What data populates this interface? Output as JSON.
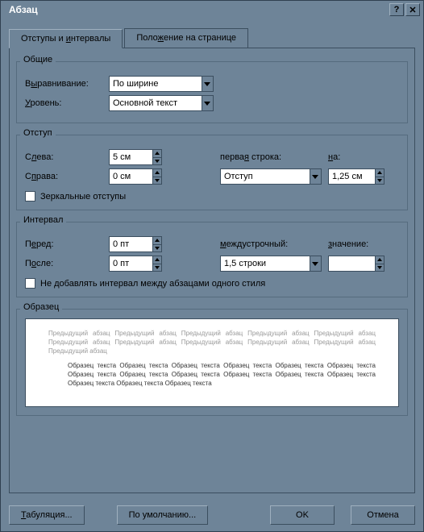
{
  "title": "Абзац",
  "tabs": {
    "indents": "Отступы и интервалы",
    "position": "Положение на странице"
  },
  "group_general": {
    "title": "Общие",
    "alignment_label": "Выравнивание:",
    "alignment_value": "По ширине",
    "level_label": "Уровень:",
    "level_value": "Основной текст"
  },
  "group_indent": {
    "title": "Отступ",
    "left_label": "Слева:",
    "left_value": "5 см",
    "right_label": "Справа:",
    "right_value": "0 см",
    "firstline_label": "первая строка:",
    "firstline_value": "Отступ",
    "by_label": "на:",
    "by_value": "1,25 см",
    "mirror_label": "Зеркальные отступы"
  },
  "group_spacing": {
    "title": "Интервал",
    "before_label": "Перед:",
    "before_value": "0 пт",
    "after_label": "После:",
    "after_value": "0 пт",
    "line_label": "междустрочный:",
    "line_value": "1,5 строки",
    "val_label": "значение:",
    "val_value": "",
    "noadd_label": "Не добавлять интервал между абзацами одного стиля"
  },
  "preview": {
    "title": "Образец",
    "prev_text": "Предыдущий абзац Предыдущий абзац Предыдущий абзац Предыдущий абзац Предыдущий абзац Предыдущий абзац Предыдущий абзац Предыдущий абзац Предыдущий абзац Предыдущий абзац Предыдущий абзац",
    "curr_text": "Образец текста Образец текста Образец текста Образец текста Образец текста Образец текста Образец текста Образец текста Образец текста Образец текста Образец текста Образец текста Образец текста Образец текста Образец текста"
  },
  "buttons": {
    "tabs": "Табуляция...",
    "default": "По умолчанию...",
    "ok": "OK",
    "cancel": "Отмена"
  }
}
